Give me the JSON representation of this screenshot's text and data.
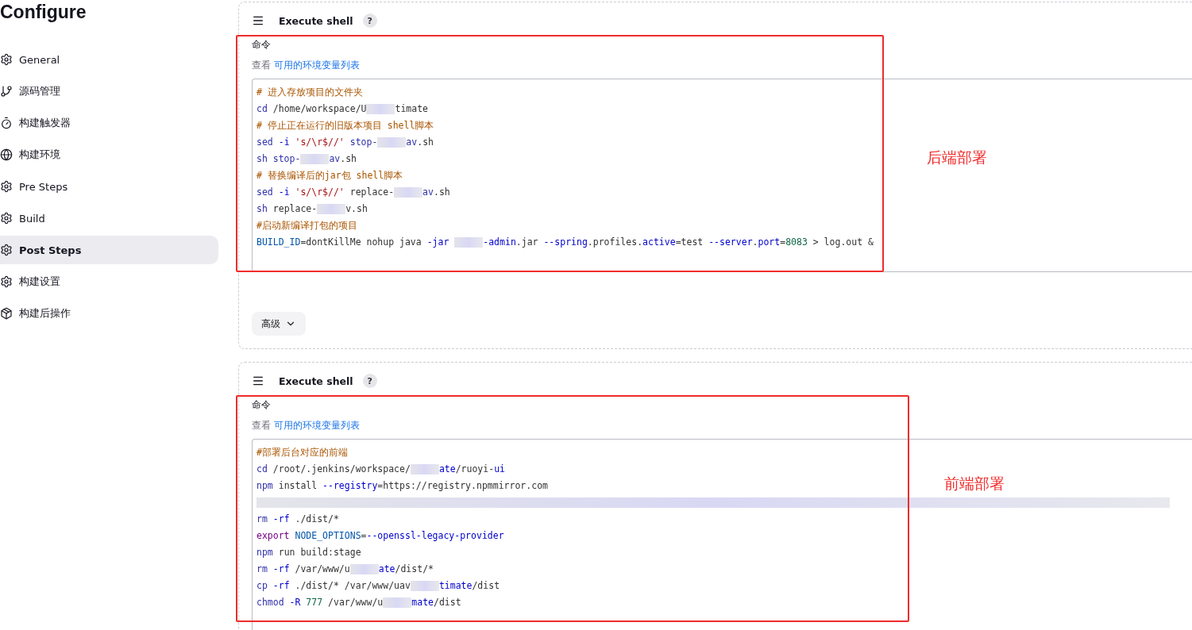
{
  "page_title": "Configure",
  "sidebar": {
    "items": [
      {
        "label": "General",
        "selected": false
      },
      {
        "label": "源码管理",
        "selected": false
      },
      {
        "label": "构建触发器",
        "selected": false
      },
      {
        "label": "构建环境",
        "selected": false
      },
      {
        "label": "Pre Steps",
        "selected": false
      },
      {
        "label": "Build",
        "selected": false
      },
      {
        "label": "Post Steps",
        "selected": true
      },
      {
        "label": "构建设置",
        "selected": false
      },
      {
        "label": "构建后操作",
        "selected": false
      }
    ]
  },
  "steps": [
    {
      "title": "Execute shell",
      "help": "?",
      "command_label": "命令",
      "env_prefix": "查看",
      "env_link": "可用的环境变量列表",
      "advanced_button": "高级",
      "annotation": "后端部署",
      "code": [
        [
          {
            "kind": "comment",
            "text": "# 进入存放项目的文件夹"
          }
        ],
        [
          {
            "kind": "builtin",
            "text": "cd"
          },
          {
            "kind": "plain",
            "text": " /home/workspace/U"
          },
          {
            "kind": "redacted"
          },
          {
            "kind": "plain",
            "text": "timate"
          }
        ],
        [
          {
            "kind": "comment",
            "text": "# 停止正在运行的旧版本项目 shell脚本"
          }
        ],
        [
          {
            "kind": "builtin",
            "text": "sed "
          },
          {
            "kind": "attribute",
            "text": "-i "
          },
          {
            "kind": "string",
            "text": "'s/\\r$//' "
          },
          {
            "kind": "builtin",
            "text": "stop-"
          },
          {
            "kind": "redacted"
          },
          {
            "kind": "builtin",
            "text": "av"
          },
          {
            "kind": "plain",
            "text": ".sh"
          }
        ],
        [
          {
            "kind": "builtin",
            "text": "sh stop-"
          },
          {
            "kind": "redacted"
          },
          {
            "kind": "builtin",
            "text": "av"
          },
          {
            "kind": "plain",
            "text": ".sh"
          }
        ],
        [
          {
            "kind": "comment",
            "text": "# 替换编译后的jar包 shell脚本"
          }
        ],
        [
          {
            "kind": "builtin",
            "text": "sed "
          },
          {
            "kind": "attribute",
            "text": "-i "
          },
          {
            "kind": "string",
            "text": "'s/\\r$//'"
          },
          {
            "kind": "plain",
            "text": " replace-"
          },
          {
            "kind": "redacted"
          },
          {
            "kind": "builtin",
            "text": "av"
          },
          {
            "kind": "plain",
            "text": ".sh"
          }
        ],
        [
          {
            "kind": "builtin",
            "text": "sh"
          },
          {
            "kind": "plain",
            "text": " replace-"
          },
          {
            "kind": "redacted"
          },
          {
            "kind": "plain",
            "text": "v.sh"
          }
        ],
        [
          {
            "kind": "comment",
            "text": "#启动新编译打包的项目"
          }
        ],
        [
          {
            "kind": "variable",
            "text": "BUILD_ID"
          },
          {
            "kind": "plain",
            "text": "=dontKillMe nohup java "
          },
          {
            "kind": "attribute",
            "text": "-jar "
          },
          {
            "kind": "redacted"
          },
          {
            "kind": "attribute",
            "text": "-admin"
          },
          {
            "kind": "plain",
            "text": ".jar "
          },
          {
            "kind": "attribute",
            "text": "--spring"
          },
          {
            "kind": "plain",
            "text": ".profiles."
          },
          {
            "kind": "attribute",
            "text": "active"
          },
          {
            "kind": "plain",
            "text": "=test "
          },
          {
            "kind": "attribute",
            "text": "--server"
          },
          {
            "kind": "plain",
            "text": "."
          },
          {
            "kind": "attribute",
            "text": "port"
          },
          {
            "kind": "plain",
            "text": "="
          },
          {
            "kind": "number",
            "text": "8083"
          },
          {
            "kind": "plain",
            "text": " > log.out &"
          }
        ]
      ]
    },
    {
      "title": "Execute shell",
      "help": "?",
      "command_label": "命令",
      "env_prefix": "查看",
      "env_link": "可用的环境变量列表",
      "annotation": "前端部署",
      "code": [
        [
          {
            "kind": "comment",
            "text": "#部署后台对应的前端"
          }
        ],
        [
          {
            "kind": "builtin",
            "text": "cd"
          },
          {
            "kind": "plain",
            "text": " /root/.jenkins/workspace/"
          },
          {
            "kind": "redacted"
          },
          {
            "kind": "attribute",
            "text": "ate"
          },
          {
            "kind": "plain",
            "text": "/ruoyi-"
          },
          {
            "kind": "attribute",
            "text": "ui"
          }
        ],
        [
          {
            "kind": "builtin",
            "text": "npm"
          },
          {
            "kind": "plain",
            "text": " install "
          },
          {
            "kind": "attribute",
            "text": "--registry"
          },
          {
            "kind": "plain",
            "text": "=https://registry.npmmirror.com"
          }
        ],
        [
          {
            "kind": "redacted_line"
          }
        ],
        [
          {
            "kind": "builtin",
            "text": "rm "
          },
          {
            "kind": "attribute",
            "text": "-rf"
          },
          {
            "kind": "plain",
            "text": " ./dist/*"
          }
        ],
        [
          {
            "kind": "keyword",
            "text": "export "
          },
          {
            "kind": "variable",
            "text": "NODE_OPTIONS"
          },
          {
            "kind": "plain",
            "text": "="
          },
          {
            "kind": "attribute",
            "text": "--openssl-legacy-provider"
          }
        ],
        [
          {
            "kind": "builtin",
            "text": "npm"
          },
          {
            "kind": "plain",
            "text": " run build:stage"
          }
        ],
        [
          {
            "kind": "builtin",
            "text": "rm "
          },
          {
            "kind": "attribute",
            "text": "-rf"
          },
          {
            "kind": "plain",
            "text": " /var/www/u"
          },
          {
            "kind": "redacted"
          },
          {
            "kind": "attribute",
            "text": "ate"
          },
          {
            "kind": "plain",
            "text": "/dist/*"
          }
        ],
        [
          {
            "kind": "builtin",
            "text": "cp "
          },
          {
            "kind": "attribute",
            "text": "-rf"
          },
          {
            "kind": "plain",
            "text": " ./dist/* /var/www/uav"
          },
          {
            "kind": "redacted"
          },
          {
            "kind": "attribute",
            "text": "timate"
          },
          {
            "kind": "plain",
            "text": "/dist"
          }
        ],
        [
          {
            "kind": "builtin",
            "text": "chmod "
          },
          {
            "kind": "attribute",
            "text": "-R "
          },
          {
            "kind": "number",
            "text": "777"
          },
          {
            "kind": "plain",
            "text": " /var/www/u"
          },
          {
            "kind": "redacted"
          },
          {
            "kind": "attribute",
            "text": "mate"
          },
          {
            "kind": "plain",
            "text": "/dist"
          }
        ]
      ]
    }
  ]
}
